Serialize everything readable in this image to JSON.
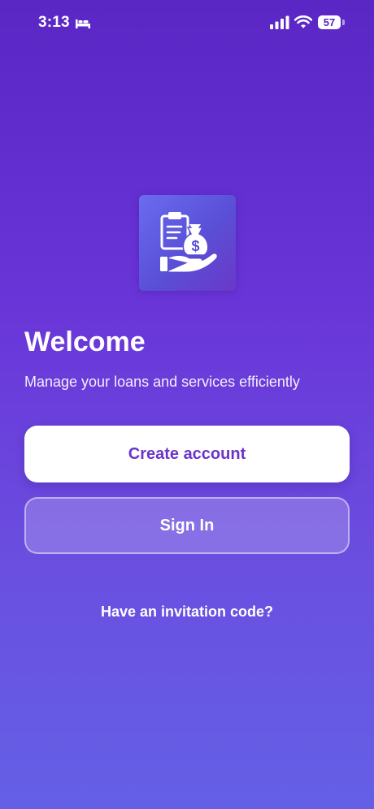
{
  "status_bar": {
    "time": "3:13",
    "battery": "57"
  },
  "welcome": {
    "title": "Welcome",
    "subtitle": "Manage your loans and services efficiently"
  },
  "buttons": {
    "create_account": "Create account",
    "sign_in": "Sign In"
  },
  "links": {
    "invitation": "Have an invitation code?"
  },
  "icons": {
    "status_activity": "bed-icon",
    "signal": "cellular-signal-icon",
    "wifi": "wifi-icon",
    "battery": "battery-icon",
    "logo": "loan-hand-money-bag-icon"
  },
  "colors": {
    "background_top": "#5a26c4",
    "background_bottom": "#6460e6",
    "primary_button_bg": "#ffffff",
    "primary_button_text": "#6a35c9"
  }
}
